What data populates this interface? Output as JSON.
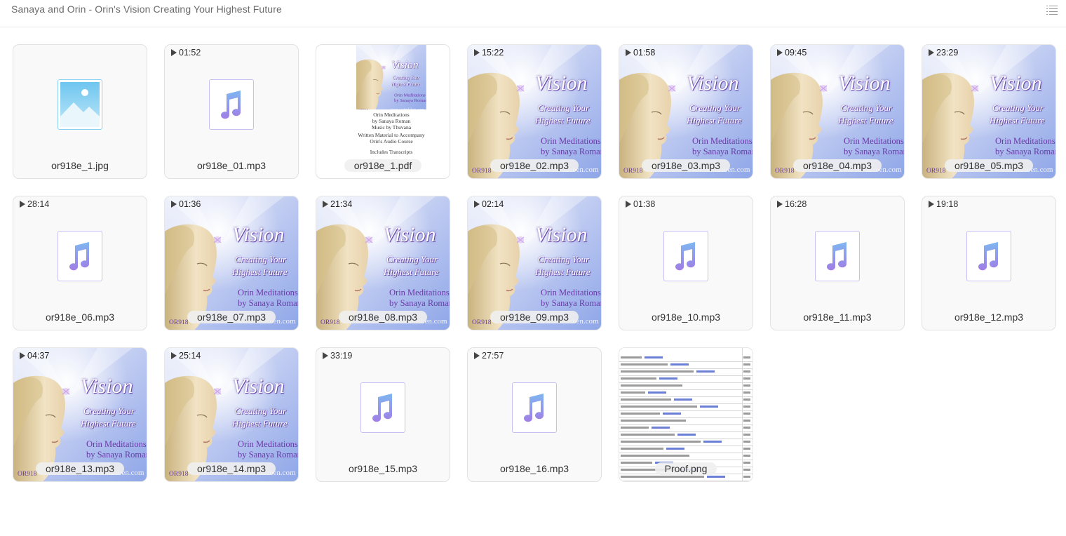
{
  "header": {
    "title": "Sanaya and Orin - Orin's Vision Creating Your Highest Future",
    "view_toggle_icon": "list-view-icon"
  },
  "art_text": {
    "title": "Vision",
    "line1": "Creating Your",
    "line2": "Highest Future",
    "line3": "Orin Meditations",
    "line4": "by Sanaya Roman",
    "code": "OR918",
    "url": "www.orindaben.com"
  },
  "pdf_text": {
    "line1": "Orin Meditations",
    "line2": "by Sanaya Roman",
    "line3": "Music by Thuvana",
    "line4": "Written Material to Accompany",
    "line5": "Orin's Audio Course",
    "line6": "Includes Transcripts"
  },
  "files": [
    {
      "name": "or918e_1.jpg",
      "kind": "image",
      "duration": ""
    },
    {
      "name": "or918e_01.mp3",
      "kind": "audio",
      "duration": "01:52"
    },
    {
      "name": "or918e_1.pdf",
      "kind": "pdf",
      "duration": ""
    },
    {
      "name": "or918e_02.mp3",
      "kind": "audio-art",
      "duration": "15:22"
    },
    {
      "name": "or918e_03.mp3",
      "kind": "audio-art",
      "duration": "01:58"
    },
    {
      "name": "or918e_04.mp3",
      "kind": "audio-art",
      "duration": "09:45"
    },
    {
      "name": "or918e_05.mp3",
      "kind": "audio-art",
      "duration": "23:29"
    },
    {
      "name": "or918e_06.mp3",
      "kind": "audio",
      "duration": "28:14"
    },
    {
      "name": "or918e_07.mp3",
      "kind": "audio-art",
      "duration": "01:36"
    },
    {
      "name": "or918e_08.mp3",
      "kind": "audio-art",
      "duration": "21:34"
    },
    {
      "name": "or918e_09.mp3",
      "kind": "audio-art",
      "duration": "02:14"
    },
    {
      "name": "or918e_10.mp3",
      "kind": "audio",
      "duration": "01:38"
    },
    {
      "name": "or918e_11.mp3",
      "kind": "audio",
      "duration": "16:28"
    },
    {
      "name": "or918e_12.mp3",
      "kind": "audio",
      "duration": "19:18"
    },
    {
      "name": "or918e_13.mp3",
      "kind": "audio-art",
      "duration": "04:37"
    },
    {
      "name": "or918e_14.mp3",
      "kind": "audio-art",
      "duration": "25:14"
    },
    {
      "name": "or918e_15.mp3",
      "kind": "audio",
      "duration": "33:19"
    },
    {
      "name": "or918e_16.mp3",
      "kind": "audio",
      "duration": "27:57"
    },
    {
      "name": "Proof.png",
      "kind": "proof",
      "duration": ""
    }
  ],
  "colors": {
    "music_note_top": "#7fb6f0",
    "music_note_bottom": "#a07ee6",
    "art_purple": "#6a3aa8",
    "art_sky": "#8ea6e8"
  },
  "icons": {
    "audio": "music-note-icon",
    "image": "image-file-icon",
    "play": "play-icon"
  }
}
